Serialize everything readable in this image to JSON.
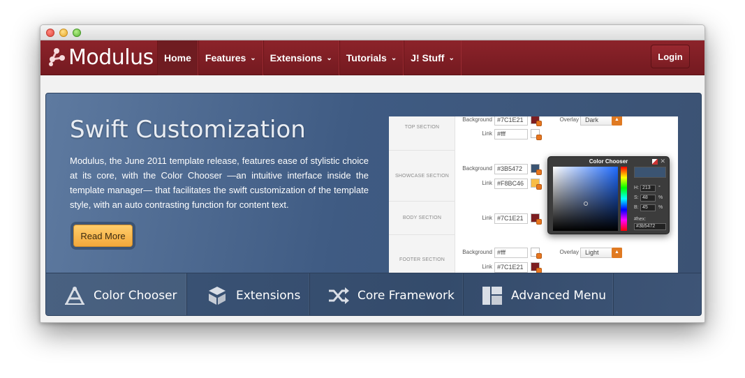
{
  "window": {
    "controls": [
      "close",
      "minimize",
      "zoom"
    ]
  },
  "navbar": {
    "logo": "Modulus",
    "items": [
      {
        "label": "Home",
        "active": true,
        "dropdown": false
      },
      {
        "label": "Features",
        "active": false,
        "dropdown": true
      },
      {
        "label": "Extensions",
        "active": false,
        "dropdown": true
      },
      {
        "label": "Tutorials",
        "active": false,
        "dropdown": true
      },
      {
        "label": "J! Stuff",
        "active": false,
        "dropdown": true
      }
    ],
    "login_label": "Login",
    "brand_color": "#7f1d24"
  },
  "hero": {
    "title": "Swift Customization",
    "text": "Modulus, the June 2011 template release, features ease of stylistic choice at its core, with the Color Chooser —an intuitive interface inside the template manager— that facilitates the swift customization of the template style, with an auto contrasting function for content text.",
    "button_label": "Read More",
    "panel": {
      "sections": [
        "TOP SECTION",
        "SHOWCASE SECTION",
        "BODY SECTION",
        "FOOTER SECTION"
      ],
      "labels": {
        "background": "Background",
        "link": "Link",
        "overlay": "Overlay"
      },
      "top": {
        "background": "#7C1E21",
        "link": "#fff",
        "overlay": "Dark"
      },
      "showcase": {
        "background": "#3B5472",
        "link": "#F8BC46"
      },
      "body": {
        "link": "#7C1E21"
      },
      "footer": {
        "background": "#fff",
        "link": "#7C1E21",
        "overlay": "Light"
      }
    },
    "chooser": {
      "title": "Color Chooser",
      "h_label": "H:",
      "h": "213",
      "h_unit": "°",
      "s_label": "S:",
      "s": "48",
      "s_unit": "%",
      "b_label": "B:",
      "b": "45",
      "b_unit": "%",
      "hex_label": "#hex:",
      "hex": "#3b5472"
    }
  },
  "features": [
    {
      "label": "Color Chooser",
      "icon": "compass-icon"
    },
    {
      "label": "Extensions",
      "icon": "box-icon"
    },
    {
      "label": "Core Framework",
      "icon": "shuffle-icon"
    },
    {
      "label": "Advanced Menu",
      "icon": "layout-icon"
    }
  ]
}
